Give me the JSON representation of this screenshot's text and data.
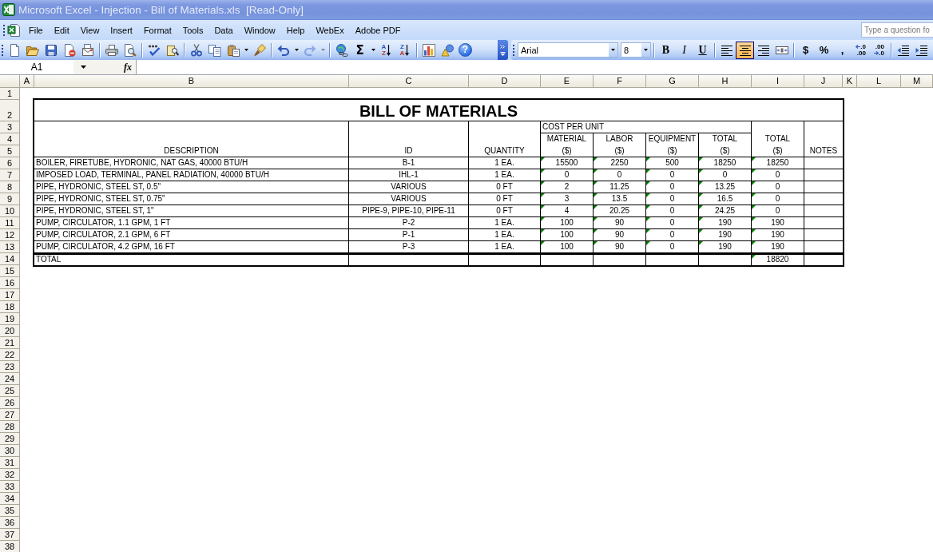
{
  "window": {
    "title": "Microsoft Excel - Injection - Bill of Materials.xls  [Read-Only]"
  },
  "menu_bar": {
    "items": [
      "File",
      "Edit",
      "View",
      "Insert",
      "Format",
      "Tools",
      "Data",
      "Window",
      "Help",
      "WebEx",
      "Adobe PDF"
    ],
    "help_box": {
      "placeholder": "Type a question fo"
    }
  },
  "standard_toolbar": {
    "groups": [
      [
        {
          "kind": "new",
          "disabled": false,
          "dropdown": false
        },
        {
          "kind": "open",
          "disabled": false,
          "dropdown": false
        },
        {
          "kind": "save",
          "disabled": false,
          "dropdown": false
        },
        {
          "kind": "permission",
          "disabled": false,
          "dropdown": false
        },
        {
          "kind": "email",
          "disabled": false,
          "dropdown": false
        }
      ],
      [
        {
          "kind": "print",
          "disabled": false,
          "dropdown": false
        },
        {
          "kind": "print_preview",
          "disabled": false,
          "dropdown": false
        }
      ],
      [
        {
          "kind": "spelling",
          "disabled": false,
          "dropdown": false
        },
        {
          "kind": "research",
          "disabled": false,
          "dropdown": false
        }
      ],
      [
        {
          "kind": "cut",
          "disabled": false,
          "dropdown": false
        },
        {
          "kind": "copy",
          "disabled": false,
          "dropdown": false
        },
        {
          "kind": "paste",
          "disabled": false,
          "dropdown": true
        },
        {
          "kind": "format_painter",
          "disabled": false,
          "dropdown": false
        }
      ],
      [
        {
          "kind": "undo",
          "disabled": false,
          "dropdown": true
        },
        {
          "kind": "redo",
          "disabled": true,
          "dropdown": true
        }
      ],
      [
        {
          "kind": "hyperlink",
          "disabled": false,
          "dropdown": false
        },
        {
          "kind": "autosum",
          "label": "Σ",
          "disabled": false,
          "dropdown": true
        },
        {
          "kind": "sort",
          "letters": [
            "A",
            "Z"
          ],
          "disabled": false,
          "dropdown": false
        },
        {
          "kind": "sort",
          "letters": [
            "Z",
            "A"
          ],
          "disabled": false,
          "dropdown": false
        }
      ],
      [
        {
          "kind": "chart",
          "disabled": false,
          "dropdown": false
        },
        {
          "kind": "drawing",
          "disabled": false,
          "dropdown": false
        },
        {
          "kind": "help",
          "label": "?",
          "disabled": false,
          "dropdown": false
        }
      ]
    ]
  },
  "formatting_toolbar": {
    "font_name": "Arial",
    "font_size": "8",
    "groups": [
      [
        {
          "kind": "bold",
          "label": "B",
          "selected": false
        },
        {
          "kind": "italic",
          "label": "I",
          "selected": false
        },
        {
          "kind": "underline",
          "label": "U",
          "selected": false
        }
      ],
      [
        {
          "kind": "align_left",
          "selected": false
        },
        {
          "kind": "align_center",
          "selected": true
        },
        {
          "kind": "align_right",
          "selected": false
        },
        {
          "kind": "merge_center",
          "selected": false
        }
      ],
      [
        {
          "kind": "currency",
          "label": "$",
          "selected": false
        },
        {
          "kind": "percent",
          "label": "%",
          "selected": false
        },
        {
          "kind": "comma",
          "label": ",",
          "selected": false
        },
        {
          "kind": "increase_decimal",
          "lines": [
            ".0",
            ".00"
          ],
          "selected": false
        },
        {
          "kind": "decrease_decimal",
          "lines": [
            ".00",
            ".0"
          ],
          "selected": false
        }
      ],
      [
        {
          "kind": "decrease_indent",
          "selected": false
        },
        {
          "kind": "increase_indent",
          "selected": false
        }
      ]
    ]
  },
  "formula_bar": {
    "name_box": {
      "value": "A1"
    },
    "function_button": "fx"
  },
  "sheet": {
    "columns": [
      "A",
      "B",
      "C",
      "D",
      "E",
      "F",
      "G",
      "H",
      "I",
      "J",
      "K",
      "L",
      "M"
    ],
    "rows": [
      "1",
      "2",
      "3",
      "4",
      "5",
      "6",
      "7",
      "8",
      "9",
      "10",
      "11",
      "12",
      "13",
      "14",
      "15",
      "16",
      "17",
      "18",
      "19",
      "20",
      "21",
      "22",
      "23",
      "24",
      "25",
      "26",
      "27",
      "28",
      "29",
      "30",
      "31",
      "32",
      "33",
      "34",
      "35",
      "36",
      "37",
      "38"
    ],
    "bill": {
      "title": "BILL OF MATERIALS",
      "headers": {
        "description": "DESCRIPTION",
        "id": "ID",
        "quantity": "QUANTITY",
        "cost_group": "COST PER UNIT",
        "cost_columns": [
          {
            "label": "MATERIAL",
            "unit": "($)"
          },
          {
            "label": "LABOR",
            "unit": "($)"
          },
          {
            "label": "EQUIPMENT",
            "unit": "($)"
          },
          {
            "label": "TOTAL",
            "unit": "($)"
          }
        ],
        "total": {
          "label": "TOTAL",
          "unit": "($)"
        },
        "notes": "NOTES"
      },
      "rows": [
        {
          "description": "BOILER, FIRETUBE, HYDRONIC, NAT GAS, 40000 BTU/H",
          "id": "B-1",
          "quantity": "1 EA.",
          "costs": [
            "15500",
            "2250",
            "500",
            "18250"
          ],
          "total": "18250",
          "flagged": true
        },
        {
          "description": "IMPOSED LOAD, TERMINAL, PANEL RADIATION, 40000 BTU/H",
          "id": "IHL-1",
          "quantity": "1 EA.",
          "costs": [
            "0",
            "0",
            "0",
            "0"
          ],
          "total": "0",
          "flagged": true
        },
        {
          "description": "PIPE, HYDRONIC, STEEL ST, 0.5\"",
          "id": "VARIOUS",
          "quantity": "0 FT",
          "costs": [
            "2",
            "11.25",
            "0",
            "13.25"
          ],
          "total": "0",
          "flagged": true
        },
        {
          "description": "PIPE, HYDRONIC, STEEL ST, 0.75\"",
          "id": "VARIOUS",
          "quantity": "0 FT",
          "costs": [
            "3",
            "13.5",
            "0",
            "16.5"
          ],
          "total": "0",
          "flagged": true
        },
        {
          "description": "PIPE, HYDRONIC, STEEL ST, 1\"",
          "id": "PIPE-9, PIPE-10, PIPE-11",
          "quantity": "0 FT",
          "costs": [
            "4",
            "20.25",
            "0",
            "24.25"
          ],
          "total": "0",
          "flagged": true
        },
        {
          "description": "PUMP, CIRCULATOR, 1.1 GPM, 1 FT",
          "id": "P-2",
          "quantity": "1 EA.",
          "costs": [
            "100",
            "90",
            "0",
            "190"
          ],
          "total": "190",
          "flagged": true
        },
        {
          "description": "PUMP, CIRCULATOR, 2.1 GPM, 6 FT",
          "id": "P-1",
          "quantity": "1 EA.",
          "costs": [
            "100",
            "90",
            "0",
            "190"
          ],
          "total": "190",
          "flagged": true
        },
        {
          "description": "PUMP, CIRCULATOR, 4.2 GPM, 16 FT",
          "id": "P-3",
          "quantity": "1 EA.",
          "costs": [
            "100",
            "90",
            "0",
            "190"
          ],
          "total": "190",
          "flagged": true
        }
      ],
      "total_row": {
        "label": "TOTAL",
        "total": "18820",
        "flagged": true
      }
    }
  }
}
